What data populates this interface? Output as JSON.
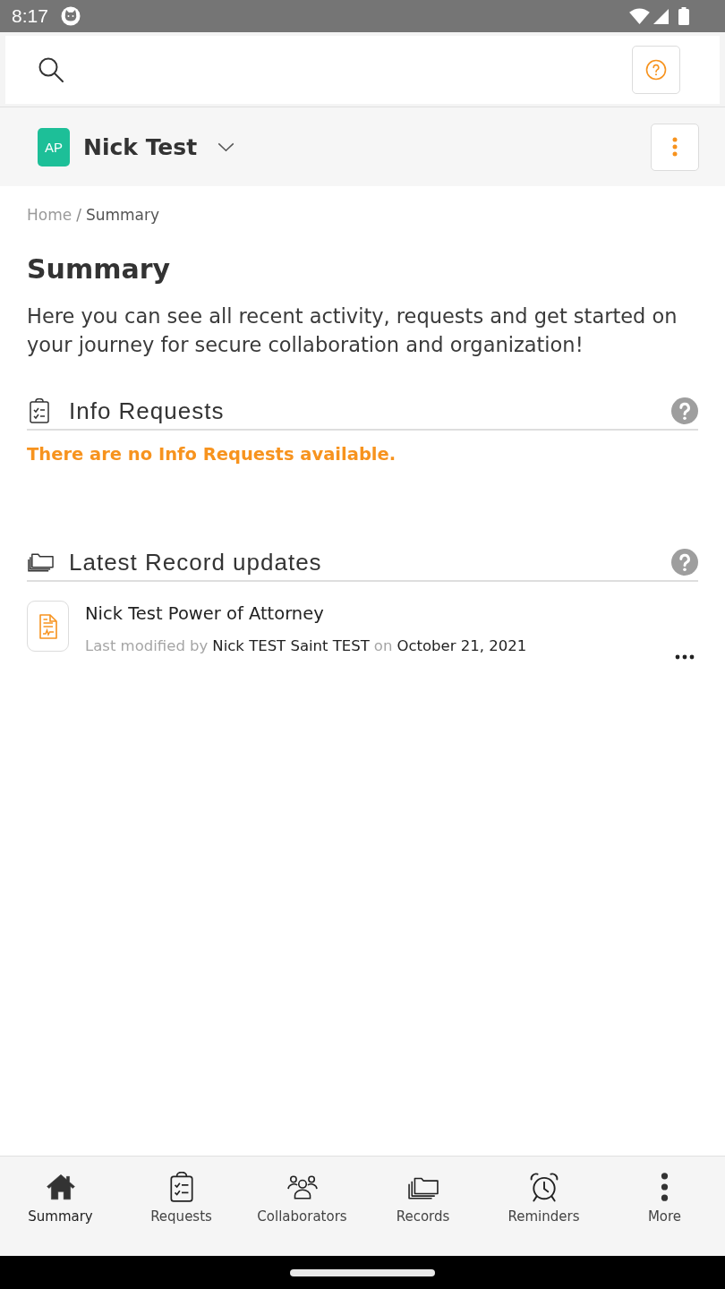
{
  "status_bar": {
    "time": "8:17"
  },
  "account": {
    "initials": "AP",
    "name": "Nick Test"
  },
  "breadcrumb": {
    "separator": "/",
    "items": [
      {
        "label": "Home",
        "current": false
      },
      {
        "label": "Summary",
        "current": true
      }
    ]
  },
  "page": {
    "title": "Summary",
    "description": "Here you can see all recent activity, requests and get started on your journey for secure collaboration and organization!"
  },
  "sections": [
    {
      "kind": "requests",
      "title": "Info Requests",
      "empty_message": "There are no Info Requests available."
    },
    {
      "kind": "records",
      "title": "Latest Record updates",
      "records": [
        {
          "title": "Nick Test Power of Attorney",
          "modified_label": "Last modified by",
          "modified_by": "Nick TEST Saint TEST",
          "date_label": "on",
          "date": "October 21, 2021"
        }
      ]
    }
  ],
  "bottom_nav": [
    {
      "kind": "home",
      "label": "Summary",
      "selected": true
    },
    {
      "kind": "requests",
      "label": "Requests",
      "selected": false
    },
    {
      "kind": "collaborators",
      "label": "Collaborators",
      "selected": false
    },
    {
      "kind": "records",
      "label": "Records",
      "selected": false
    },
    {
      "kind": "reminders",
      "label": "Reminders",
      "selected": false
    },
    {
      "kind": "more",
      "label": "More",
      "selected": false
    }
  ]
}
